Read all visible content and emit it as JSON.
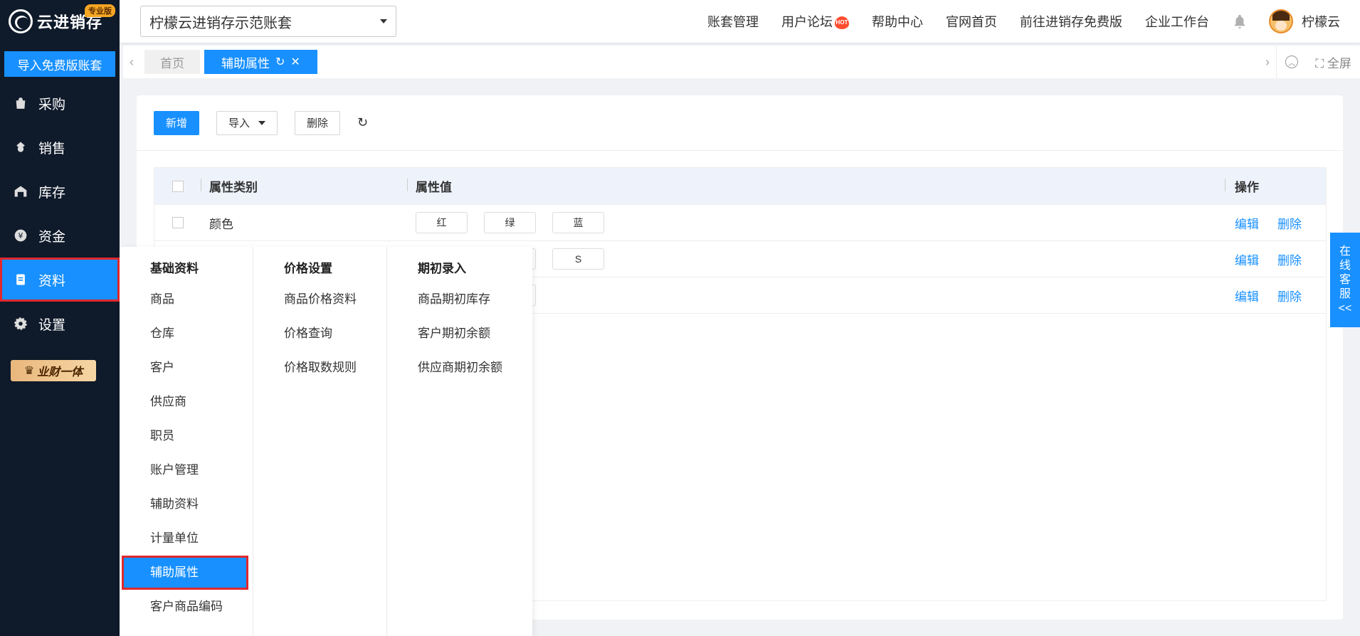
{
  "brand": {
    "logo_text": "云进销存",
    "badge": "专业版"
  },
  "sidebar": {
    "import_free_label": "导入免费版账套",
    "items": [
      {
        "label": "采购",
        "icon": "shopping-bag-icon"
      },
      {
        "label": "销售",
        "icon": "money-bag-icon"
      },
      {
        "label": "库存",
        "icon": "warehouse-icon"
      },
      {
        "label": "资金",
        "icon": "yen-circle-icon"
      },
      {
        "label": "资料",
        "icon": "document-icon",
        "active": true
      },
      {
        "label": "设置",
        "icon": "gear-icon"
      }
    ],
    "crown_badge": "业财一体"
  },
  "topbar": {
    "account_select_value": "柠檬云进销存示范账套",
    "links": [
      "账套管理",
      "用户论坛",
      "帮助中心",
      "官网首页",
      "前往进销存免费版",
      "企业工作台"
    ],
    "hot_badge": "HOT",
    "user_name": "柠檬云"
  },
  "tabs": {
    "home": "首页",
    "current": "辅助属性",
    "fullscreen_label": "全屏"
  },
  "toolbar": {
    "add_label": "新增",
    "import_label": "导入",
    "delete_label": "删除"
  },
  "table": {
    "headers": {
      "category": "属性类别",
      "value": "属性值",
      "actions": "操作"
    },
    "rows": [
      {
        "category": "颜色",
        "values": [
          "红",
          "绿",
          "蓝"
        ]
      },
      {
        "category": "",
        "values": [
          "",
          "",
          "S"
        ]
      },
      {
        "category": "",
        "values": [
          "",
          ""
        ]
      }
    ],
    "edit_label": "编辑",
    "delete_label": "删除"
  },
  "online_service": {
    "chars": [
      "在",
      "线",
      "客",
      "服",
      "<<"
    ]
  },
  "mega_menu": {
    "columns": [
      {
        "title": "基础资料",
        "items": [
          "商品",
          "仓库",
          "客户",
          "供应商",
          "职员",
          "账户管理",
          "辅助资料",
          "计量单位",
          "辅助属性",
          "客户商品编码"
        ]
      },
      {
        "title": "价格设置",
        "items": [
          "商品价格资料",
          "价格查询",
          "价格取数规则"
        ]
      },
      {
        "title": "期初录入",
        "items": [
          "商品期初库存",
          "客户期初余额",
          "供应商期初余额"
        ]
      }
    ],
    "selected_item": "辅助属性"
  },
  "colors": {
    "sidebar_bg": "#0f1a2a",
    "accent": "#1890ff",
    "highlight_border": "#e0282e"
  }
}
